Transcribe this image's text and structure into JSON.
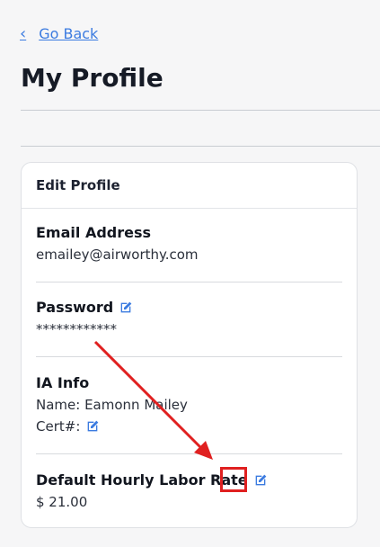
{
  "nav": {
    "back_label": "Go Back",
    "back_icon": "chevron-left-icon"
  },
  "page": {
    "title": "My Profile"
  },
  "card": {
    "header": "Edit Profile",
    "email": {
      "label": "Email Address",
      "value": "emailey@airworthy.com"
    },
    "password": {
      "label": "Password",
      "value": "************",
      "edit_icon": "edit-icon"
    },
    "ia_info": {
      "label": "IA Info",
      "name_line": "Name: Eamonn Mailey",
      "cert_label": "Cert#:",
      "edit_icon": "edit-icon"
    },
    "labor_rate": {
      "label": "Default Hourly Labor Rate",
      "value": "$ 21.00",
      "edit_icon": "edit-icon"
    }
  },
  "colors": {
    "accent": "#3b7be0",
    "annotation": "#e02020"
  }
}
